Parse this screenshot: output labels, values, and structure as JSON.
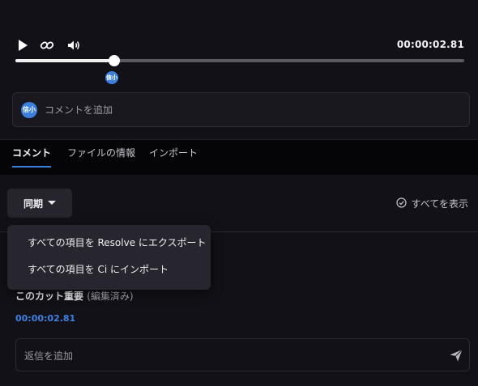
{
  "player": {
    "timecode": "00:00:02.81",
    "progress_fraction": 0.22,
    "marker_avatar_initials": "信小",
    "icons": [
      "play-icon",
      "link-icon",
      "volume-icon"
    ]
  },
  "new_comment": {
    "avatar_initials": "信小",
    "placeholder": "コメントを追加"
  },
  "tabs": [
    {
      "label": "コメント",
      "active": true
    },
    {
      "label": "ファイルの情報",
      "active": false
    },
    {
      "label": "インポート",
      "active": false
    }
  ],
  "toolbar": {
    "sync_label": "同期",
    "show_all_label": "すべてを表示"
  },
  "sync_menu": {
    "items": [
      {
        "label": "すべての項目を Resolve にエクスポート"
      },
      {
        "label": "すべての項目を Ci にインポート"
      }
    ]
  },
  "comment": {
    "title": "このカット重要",
    "edited": "(編集済み)",
    "timecode": "00:00:02.81"
  },
  "reply": {
    "placeholder": "返信を追加"
  },
  "colors": {
    "accent": "#3b82e6",
    "background": "#121117",
    "menu_bg": "#27262e"
  }
}
